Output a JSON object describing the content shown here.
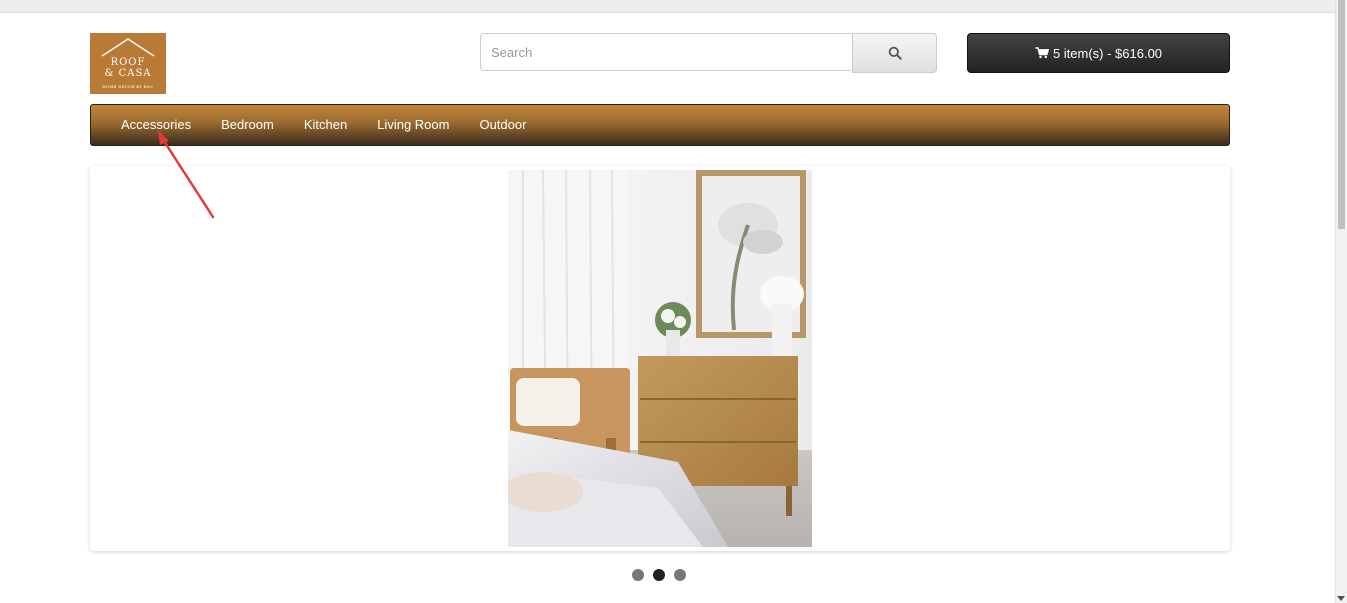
{
  "logo": {
    "line1": "ROOF",
    "line2": "& CASA",
    "tagline": "HOME DECOR BY R&C",
    "icon": "roof-icon",
    "color": "#b97a36"
  },
  "search": {
    "placeholder": "Search",
    "value": "",
    "button_icon": "search-icon"
  },
  "cart": {
    "icon": "cart-icon",
    "label": "5 item(s) - $616.00"
  },
  "nav": {
    "items": [
      "Accessories",
      "Bedroom",
      "Kitchen",
      "Living Room",
      "Outdoor"
    ]
  },
  "slider": {
    "slide_count": 3,
    "active_index": 1
  },
  "colors": {
    "nav_top": "#c28538",
    "nav_bottom": "#3b2c1c",
    "cart_bg": "#2b2b2b",
    "annotation_arrow": "#e53935"
  }
}
